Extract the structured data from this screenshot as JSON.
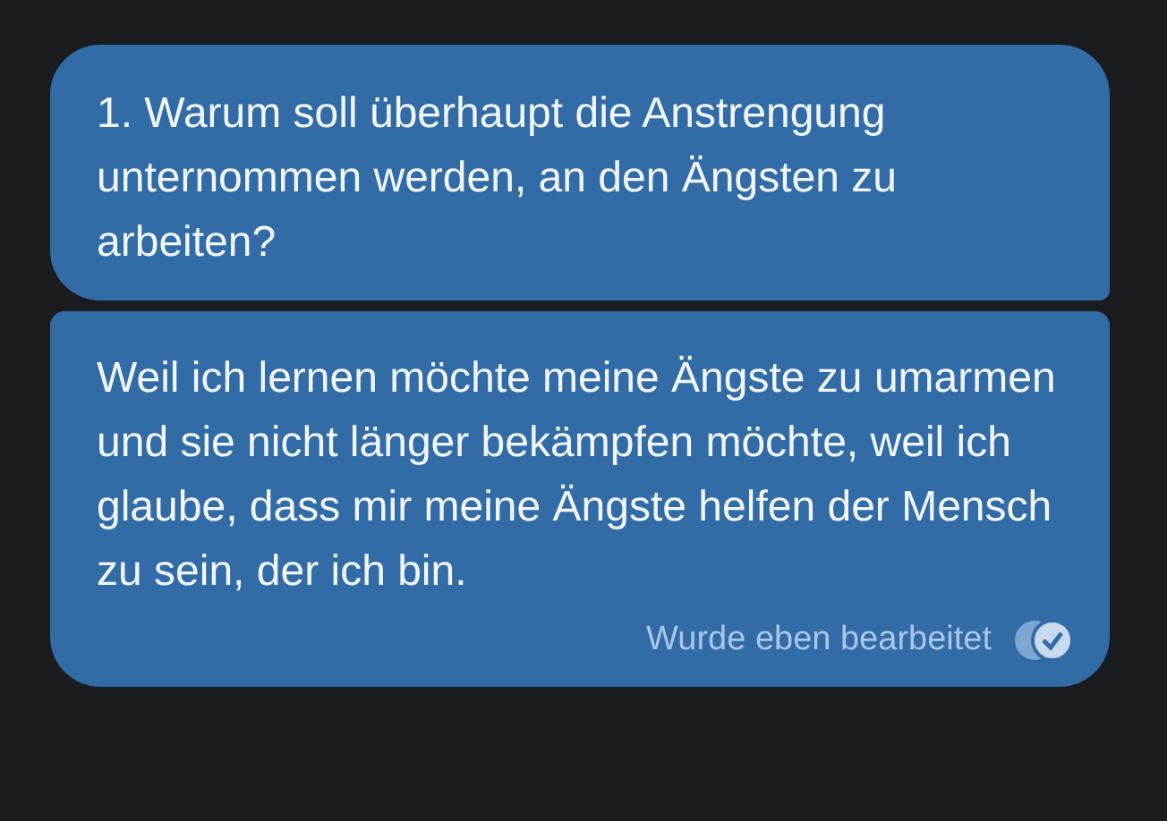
{
  "messages": [
    {
      "text": "1. Warum soll überhaupt die Anstrengung unternommen werden, an den Ängsten zu arbeiten?"
    },
    {
      "text": "Weil ich lernen möchte meine Ängste zu umarmen und sie nicht länger bekämpfen möchte, weil ich glaube, dass mir meine Ängste helfen der Mensch zu sein, der ich bin.",
      "status": "Wurde eben bearbeitet",
      "read": true
    }
  ]
}
